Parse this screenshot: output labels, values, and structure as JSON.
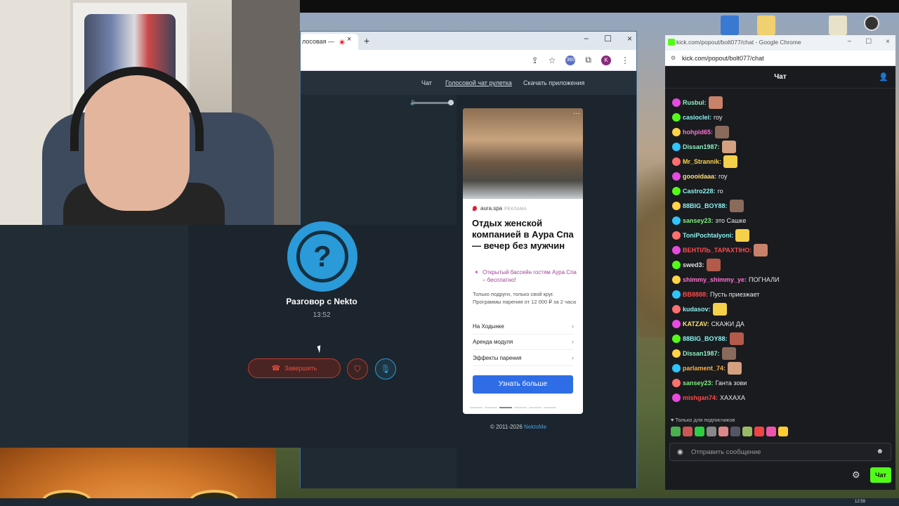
{
  "nekto": {
    "tab_title": "лосовая —",
    "tab_close": "×",
    "tab_new": "+",
    "win_min": "−",
    "win_max": "☐",
    "win_close": "×",
    "nav": {
      "chat": "Чат",
      "voice": "Голосовой чат рулетка",
      "download": "Скачать приложения"
    },
    "ad": {
      "source": "aura.spa",
      "source_label": "РЕКЛАМА",
      "title": "Отдых женской компанией в Аура Спа — вечер без мужчин",
      "promo": "Открытый бассейн гостям Аура Спа – бесплатно!",
      "desc": "Только подруги, только свой круг. Программы парения от 12 000 ₽ за 2 часа",
      "links": [
        "На Ходынке",
        "Аренда модуля",
        "Эффекты парения"
      ],
      "button": "Узнать больше"
    },
    "copyright": "© 2011-2026",
    "copyright_link": "NektoMe",
    "call": {
      "name": "Разговор с Nekto",
      "time": "13:52",
      "end": "Завершить",
      "avatar_glyph": "?"
    }
  },
  "kick": {
    "window_title": "kick.com/popout/bolt077/chat - Google Chrome",
    "url": "kick.com/popout/bolt077/chat",
    "header": "Чат",
    "messages": [
      {
        "user": "Rusbul:",
        "text": "",
        "color": "#8cf0c0"
      },
      {
        "user": "casioclei:",
        "text": "гоу",
        "color": "#8cf0f0"
      },
      {
        "user": "hohpid65:",
        "text": "",
        "color": "#ff6fd0"
      },
      {
        "user": "Dissan1987:",
        "text": "",
        "color": "#8cf0c0"
      },
      {
        "user": "Mr_Strannik:",
        "text": "",
        "color": "#ffd24a"
      },
      {
        "user": "goooidaaa:",
        "text": "гоу",
        "color": "#ffe070"
      },
      {
        "user": "Castro228:",
        "text": "го",
        "color": "#8cf0f0"
      },
      {
        "user": "88BIG_BOY88:",
        "text": "",
        "color": "#8cf0f0"
      },
      {
        "user": "sansey23:",
        "text": "это Сашке",
        "color": "#7df07d"
      },
      {
        "user": "ToniPochtalyoni:",
        "text": "",
        "color": "#8cf0f0"
      },
      {
        "user": "ВЕНТІЛЬ_ТАРАХТІНО:",
        "text": "",
        "color": "#ff4a4a"
      },
      {
        "user": "swed3:",
        "text": "",
        "color": "#e0e0e0"
      },
      {
        "user": "shimmy_shimmy_ye:",
        "text": "ПОГНАЛИ",
        "color": "#ff6fd0"
      },
      {
        "user": "BB8888:",
        "text": "Пусть приезжает",
        "color": "#ff4a4a"
      },
      {
        "user": "kudasov:",
        "text": "",
        "color": "#8cf0f0"
      },
      {
        "user": "KATZAV:",
        "text": "СКАЖИ ДА",
        "color": "#ffe070"
      },
      {
        "user": "88BIG_BOY88:",
        "text": "",
        "color": "#8cf0f0"
      },
      {
        "user": "Dissan1987:",
        "text": "",
        "color": "#8cf0c0"
      },
      {
        "user": "parlament_74:",
        "text": "",
        "color": "#ffb040"
      },
      {
        "user": "sansey23:",
        "text": "Ганта зови",
        "color": "#7df07d"
      },
      {
        "user": "mishgan74:",
        "text": "ХАХАХА",
        "color": "#ff4a4a"
      }
    ],
    "subs_only": "Только для подписчиков",
    "input_placeholder": "Отправить сообщение",
    "send": "Чат"
  },
  "taskbar": {
    "clock": "12:59"
  }
}
